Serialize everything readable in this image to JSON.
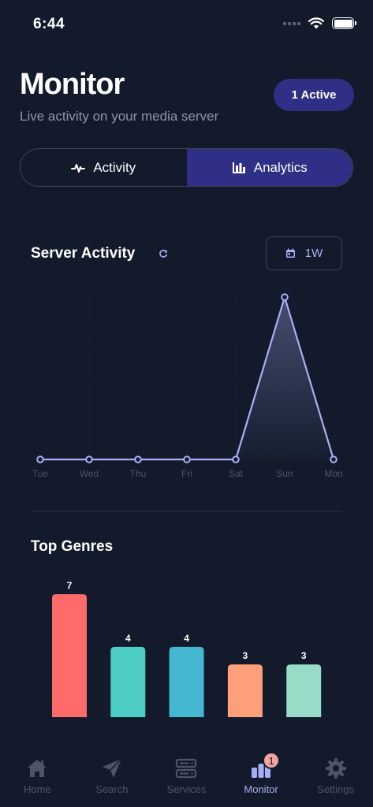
{
  "status_bar": {
    "time": "6:44"
  },
  "header": {
    "title": "Monitor",
    "subtitle": "Live activity on your media server",
    "active_badge": "1 Active"
  },
  "segments": [
    {
      "label": "Activity",
      "icon": "activity-pulse-icon",
      "selected": false
    },
    {
      "label": "Analytics",
      "icon": "bar-chart-icon",
      "selected": true
    }
  ],
  "server_activity": {
    "title": "Server Activity",
    "range_label": "1W"
  },
  "top_genres": {
    "title": "Top Genres"
  },
  "chart_data": [
    {
      "type": "line",
      "categories": [
        "Tue",
        "Wed",
        "Thu",
        "Fri",
        "Sat",
        "Sun",
        "Mon"
      ],
      "values": [
        0,
        0,
        0,
        0,
        0,
        1,
        0
      ],
      "ylim": [
        0,
        1
      ],
      "grid": true,
      "area_fill": true,
      "color": "#a8b0f5"
    },
    {
      "type": "bar",
      "values": [
        7,
        4,
        4,
        3,
        3
      ],
      "colors": [
        "#ff6b6b",
        "#4ecdc4",
        "#45b7d1",
        "#ffa07a",
        "#98dbc6"
      ],
      "ylim": [
        0,
        7
      ]
    }
  ],
  "tab_bar": {
    "items": [
      {
        "label": "Home",
        "icon": "home-icon"
      },
      {
        "label": "Search",
        "icon": "send-icon"
      },
      {
        "label": "Services",
        "icon": "server-icon"
      },
      {
        "label": "Monitor",
        "icon": "monitor-chart-icon",
        "badge": "1",
        "active": true
      },
      {
        "label": "Settings",
        "icon": "gear-icon"
      }
    ]
  },
  "colors": {
    "background": "#121a2b",
    "accent": "#2f2f86",
    "accent_text": "#a8b0f5",
    "inactive": "#4c5466"
  }
}
